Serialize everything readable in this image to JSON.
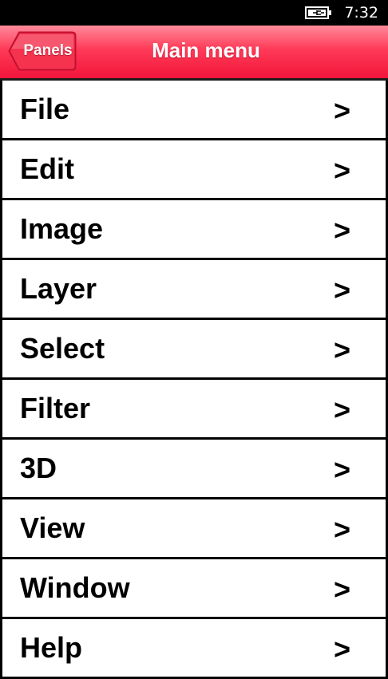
{
  "status_bar": {
    "time": "7:32",
    "battery_icon": "battery-charging-icon"
  },
  "header": {
    "back_label": "Panels",
    "title": "Main menu",
    "accent_color": "#ff3a58"
  },
  "menu": {
    "chevron": ">",
    "items": [
      {
        "label": "File"
      },
      {
        "label": "Edit"
      },
      {
        "label": "Image"
      },
      {
        "label": "Layer"
      },
      {
        "label": "Select"
      },
      {
        "label": "Filter"
      },
      {
        "label": "3D"
      },
      {
        "label": "View"
      },
      {
        "label": "Window"
      },
      {
        "label": "Help"
      }
    ]
  }
}
